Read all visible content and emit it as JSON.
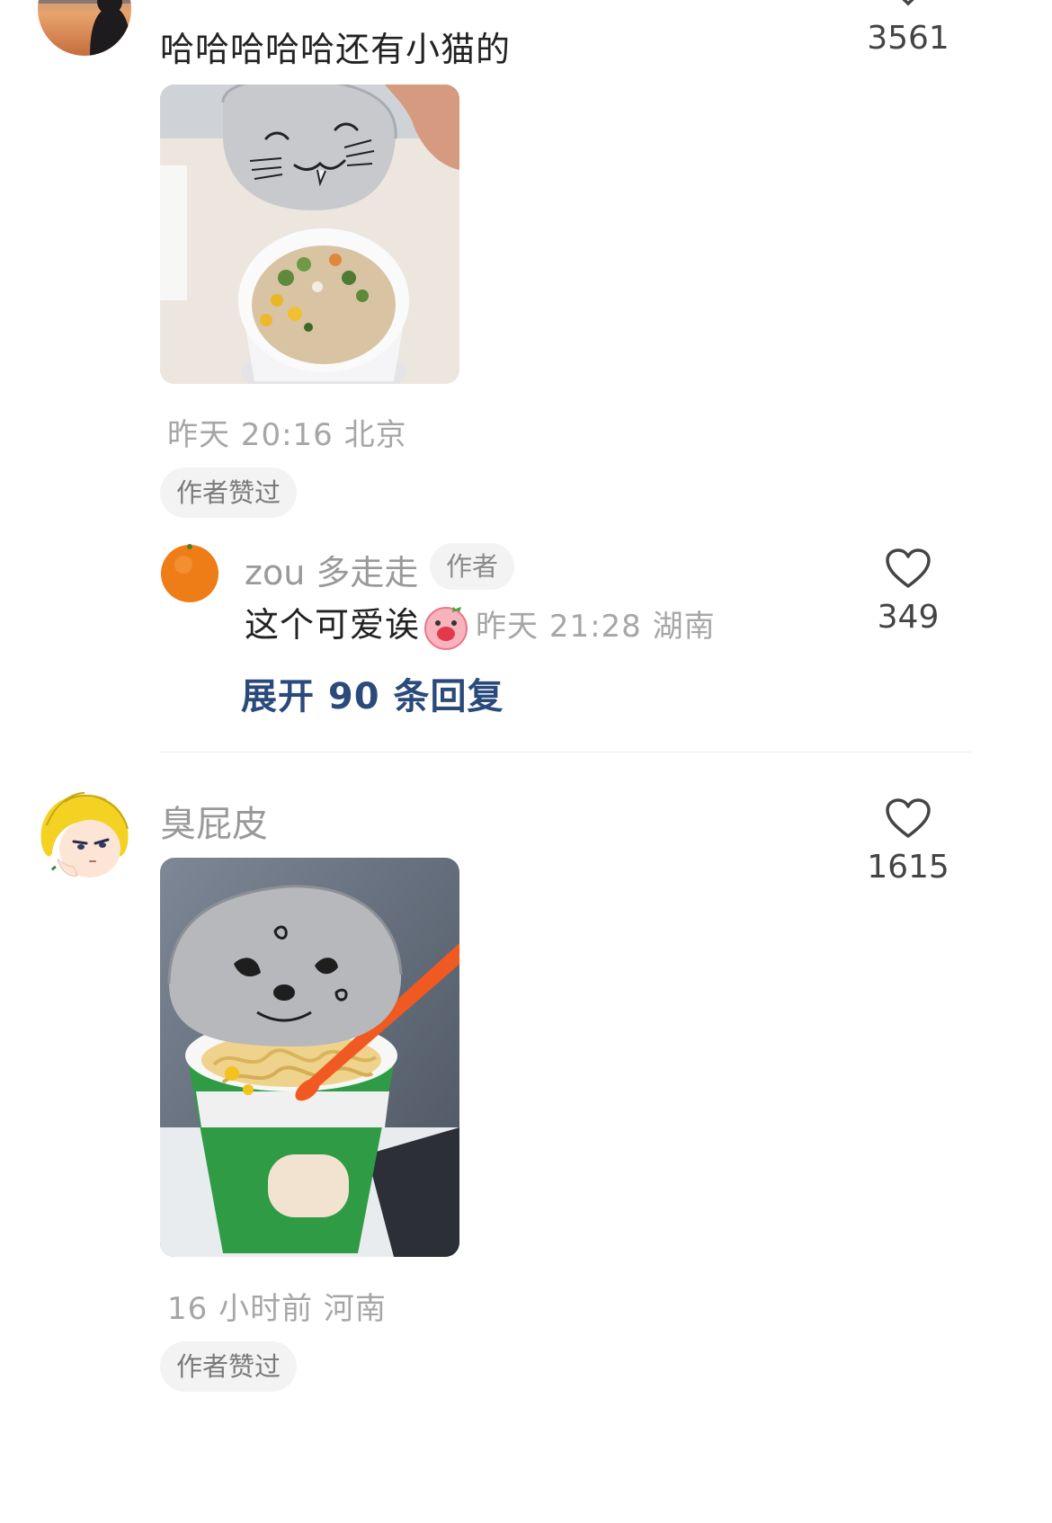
{
  "comments": [
    {
      "text": "哈哈哈哈哈还有小猫的",
      "like_count": "3561",
      "meta": "昨天 20:16 北京",
      "author_badge": "作者赞过",
      "reply": {
        "username": "zou 多走走",
        "tag": "作者",
        "text": "这个可爱诶",
        "meta": "昨天 21:28 湖南",
        "like_count": "349"
      },
      "expand_label": "展开 90 条回复"
    },
    {
      "username": "臭屁皮",
      "like_count": "1615",
      "meta": "16 小时前 河南",
      "author_badge": "作者赞过"
    }
  ],
  "icons": {
    "like": "heart-outline-icon",
    "emoji": "pig-face-emoji-icon"
  },
  "colors": {
    "link": "#2b4a7c",
    "meta": "#a6a6a6",
    "username": "#999999",
    "badge_bg": "#f3f3f3"
  }
}
